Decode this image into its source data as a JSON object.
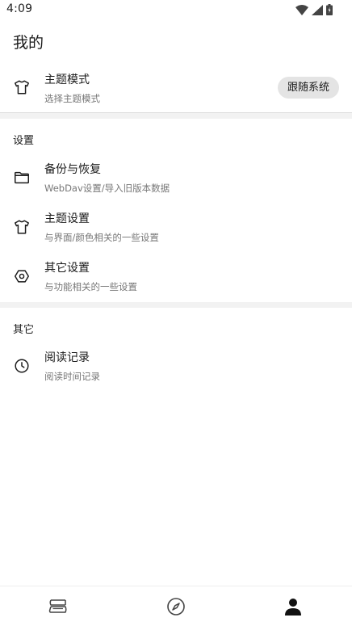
{
  "status_bar": {
    "time": "4:09",
    "icons": [
      "wifi-icon",
      "signal-icon",
      "battery-icon"
    ]
  },
  "page": {
    "title": "我的"
  },
  "theme_mode": {
    "icon": "tshirt-icon",
    "title": "主题模式",
    "subtitle": "选择主题模式",
    "value": "跟随系统"
  },
  "settings_section": {
    "header": "设置",
    "items": [
      {
        "icon": "folder-icon",
        "title": "备份与恢复",
        "subtitle": "WebDav设置/导入旧版本数据"
      },
      {
        "icon": "tshirt-icon",
        "title": "主题设置",
        "subtitle": "与界面/颜色相关的一些设置"
      },
      {
        "icon": "hexagon-settings-icon",
        "title": "其它设置",
        "subtitle": "与功能相关的一些设置"
      }
    ]
  },
  "other_section": {
    "header": "其它",
    "items": [
      {
        "icon": "clock-icon",
        "title": "阅读记录",
        "subtitle": "阅读时间记录"
      }
    ]
  },
  "bottom_nav": {
    "items": [
      {
        "icon": "bookshelf-icon",
        "active": false
      },
      {
        "icon": "compass-icon",
        "active": false
      },
      {
        "icon": "person-icon",
        "active": true
      }
    ]
  },
  "colors": {
    "background": "#ffffff",
    "chip_background": "#e4e4e4",
    "subtitle_text": "#777777",
    "band": "#f2f2f2"
  }
}
